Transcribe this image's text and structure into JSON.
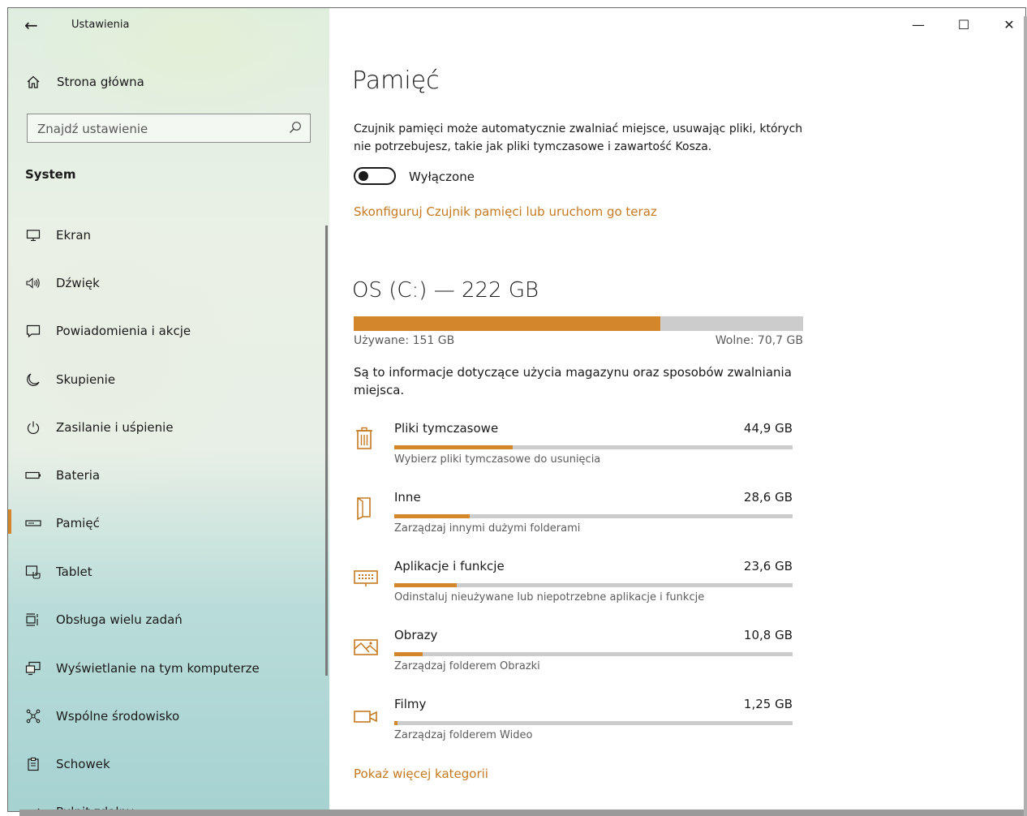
{
  "window": {
    "title": "Ustawienia",
    "controls": {
      "minimize": "—",
      "maximize": "☐",
      "close": "✕"
    }
  },
  "sidebar": {
    "home_label": "Strona główna",
    "search_placeholder": "Znajdź ustawienie",
    "section_title": "System",
    "items": [
      {
        "label": "Ekran",
        "icon": "monitor-icon"
      },
      {
        "label": "Dźwięk",
        "icon": "speaker-icon"
      },
      {
        "label": "Powiadomienia i akcje",
        "icon": "notification-icon"
      },
      {
        "label": "Skupienie",
        "icon": "moon-icon"
      },
      {
        "label": "Zasilanie i uśpienie",
        "icon": "power-icon"
      },
      {
        "label": "Bateria",
        "icon": "battery-icon"
      },
      {
        "label": "Pamięć",
        "icon": "storage-icon",
        "active": true
      },
      {
        "label": "Tablet",
        "icon": "tablet-icon"
      },
      {
        "label": "Obsługa wielu zadań",
        "icon": "multitasking-icon"
      },
      {
        "label": "Wyświetlanie na tym komputerze",
        "icon": "project-icon"
      },
      {
        "label": "Wspólne środowisko",
        "icon": "shared-experience-icon"
      },
      {
        "label": "Schowek",
        "icon": "clipboard-icon"
      },
      {
        "label": "Pulpit zdalny",
        "icon": "remote-desktop-icon"
      }
    ],
    "accent_color": "#d4862a"
  },
  "main": {
    "title": "Pamięć",
    "description": "Czujnik pamięci może automatycznie zwalniać miejsce, usuwając pliki, których nie potrzebujesz, takie jak pliki tymczasowe i zawartość Kosza.",
    "toggle": {
      "state": "off",
      "label": "Wyłączone"
    },
    "configure_link": "Skonfiguruj Czujnik pamięci lub uruchom go teraz",
    "drive": {
      "title": "OS (C:) — 222 GB",
      "used_label": "Używane: 151 GB",
      "free_label": "Wolne: 70,7 GB",
      "used_fraction": 0.682
    },
    "info_text": "Są to informacje dotyczące użycia magazynu oraz sposobów zwalniania miejsca.",
    "categories": [
      {
        "name": "Pliki tymczasowe",
        "size": "44,9 GB",
        "subtitle": "Wybierz pliki tymczasowe do usunięcia",
        "fraction": 0.297,
        "icon": "trash-icon"
      },
      {
        "name": "Inne",
        "size": "28,6 GB",
        "subtitle": "Zarządzaj innymi dużymi folderami",
        "fraction": 0.189,
        "icon": "document-icon"
      },
      {
        "name": "Aplikacje i funkcje",
        "size": "23,6 GB",
        "subtitle": "Odinstaluj nieużywane lub niepotrzebne aplikacje i funkcje",
        "fraction": 0.156,
        "icon": "keyboard-icon"
      },
      {
        "name": "Obrazy",
        "size": "10,8 GB",
        "subtitle": "Zarządzaj folderem Obrazki",
        "fraction": 0.071,
        "icon": "picture-icon"
      },
      {
        "name": "Filmy",
        "size": "1,25 GB",
        "subtitle": "Zarządzaj folderem Wideo",
        "fraction": 0.008,
        "icon": "video-icon"
      }
    ],
    "show_more_link": "Pokaż więcej kategorii",
    "link_color": "#c57a1f"
  }
}
